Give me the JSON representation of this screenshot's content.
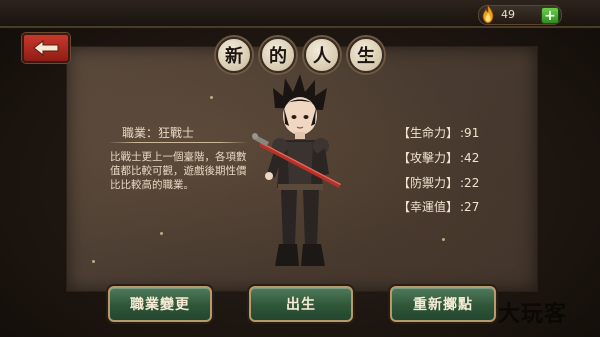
{
  "header": {
    "resource_value": "49",
    "resource_icon": "flame-icon",
    "plus_label": "+",
    "back_icon": "back-arrow-icon"
  },
  "title": {
    "chars": [
      "新",
      "的",
      "人",
      "生"
    ]
  },
  "character": {
    "class_label": "職業：狂戰士",
    "description": "比戰士更上一個臺階，各項數值都比較可觀，遊戲後期性價比比較高的職業。"
  },
  "stats": [
    {
      "label": "【生命力】",
      "value": ":91"
    },
    {
      "label": "【攻擊力】",
      "value": ":42"
    },
    {
      "label": "【防禦力】",
      "value": ":22"
    },
    {
      "label": "【幸運值】",
      "value": ":27"
    }
  ],
  "buttons": {
    "change_class": "職業變更",
    "birth": "出生",
    "reroll": "重新擲點"
  },
  "watermark": "大玩客",
  "colors": {
    "button_green": "#2f5638",
    "back_red": "#c8382c",
    "plus_green": "#3fae2a"
  }
}
